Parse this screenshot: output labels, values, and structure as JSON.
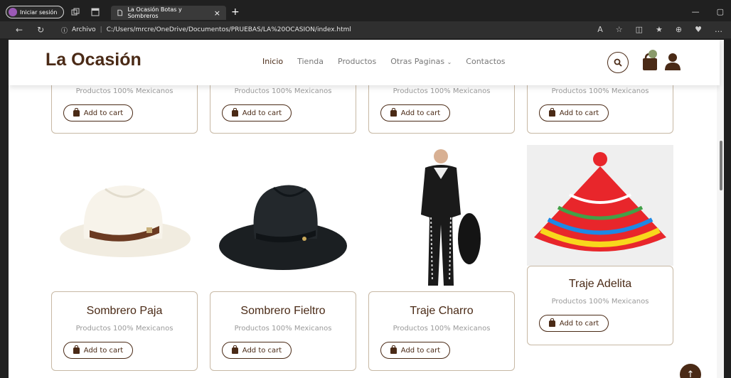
{
  "browser": {
    "profile_label": "Iniciar sesión",
    "tab_title": "La Ocasión Botas y Sombreros",
    "tab_close": "×",
    "new_tab": "+",
    "address_security": "Archivo",
    "address_url": "C:/Users/mrcre/OneDrive/Documentos/PRUEBAS/LA%20OCASION/index.html"
  },
  "site": {
    "logo": "La Ocasión",
    "menu": [
      {
        "label": "Inicio"
      },
      {
        "label": "Tienda"
      },
      {
        "label": "Productos"
      },
      {
        "label": "Otras Paginas"
      },
      {
        "label": "Contactos"
      }
    ]
  },
  "products_top_row": [
    {
      "desc": "Productos 100% Mexicanos",
      "button": "Add to cart"
    },
    {
      "desc": "Productos 100% Mexicanos",
      "button": "Add to cart"
    },
    {
      "desc": "Productos 100% Mexicanos",
      "button": "Add to cart"
    },
    {
      "desc": "Productos 100% Mexicanos",
      "button": "Add to cart"
    }
  ],
  "products": [
    {
      "name": "Sombrero Paja",
      "desc": "Productos 100% Mexicanos",
      "button": "Add to cart"
    },
    {
      "name": "Sombrero Fieltro",
      "desc": "Productos 100% Mexicanos",
      "button": "Add to cart"
    },
    {
      "name": "Traje Charro",
      "desc": "Productos 100% Mexicanos",
      "button": "Add to cart"
    },
    {
      "name": "Traje Adelita",
      "desc": "Productos 100% Mexicanos",
      "button": "Add to cart"
    }
  ],
  "colors": {
    "brand": "#4a2a16",
    "card_border": "#c7b8a4",
    "muted": "#9a9a9a"
  }
}
